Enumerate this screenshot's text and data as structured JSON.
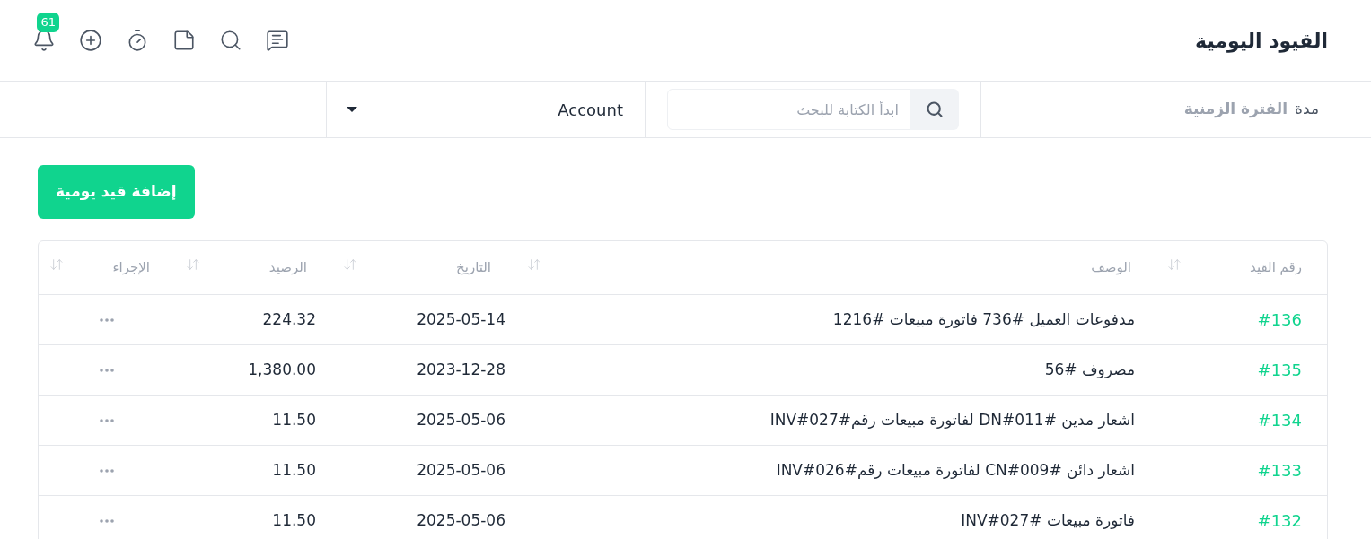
{
  "header": {
    "title": "القيود اليومية",
    "icons": [
      {
        "kind": "chat"
      },
      {
        "kind": "search"
      },
      {
        "kind": "note"
      },
      {
        "kind": "timer"
      },
      {
        "kind": "add"
      },
      {
        "kind": "bell",
        "badge": "61"
      }
    ]
  },
  "filters": {
    "period": {
      "label": "مدة",
      "value": "الفترة الزمنية"
    },
    "search": {
      "placeholder": "ابدأ الكتابة للبحث"
    },
    "account": {
      "value": "Account"
    }
  },
  "add_button": "إضافة قيد يومية",
  "table": {
    "columns": [
      "رقم القيد",
      "الوصف",
      "التاريخ",
      "الرصيد",
      "الإجراء"
    ],
    "rows": [
      {
        "number": "#136",
        "description": "مدفوعات العميل #736 فاتورة مبيعات #1216",
        "date": "2025-05-14",
        "balance": "224.32"
      },
      {
        "number": "#135",
        "description": "مصروف #56",
        "date": "2023-12-28",
        "balance": "1,380.00"
      },
      {
        "number": "#134",
        "description": "اشعار مدين #DN#011 لفاتورة مبيعات رقم#INV#027",
        "date": "2025-05-06",
        "balance": "11.50"
      },
      {
        "number": "#133",
        "description": "اشعار دائن #CN#009 لفاتورة مبيعات رقم#INV#026",
        "date": "2025-05-06",
        "balance": "11.50"
      },
      {
        "number": "#132",
        "description": "فاتورة مبيعات #INV#027",
        "date": "2025-05-06",
        "balance": "11.50"
      }
    ]
  }
}
